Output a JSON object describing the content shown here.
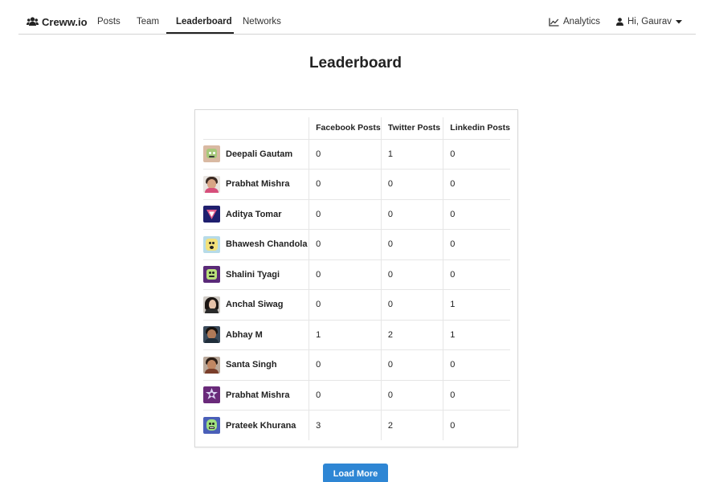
{
  "brand": {
    "name": "Creww.io",
    "icon": "users-icon"
  },
  "nav": {
    "links": [
      {
        "label": "Posts"
      },
      {
        "label": "Team"
      },
      {
        "label": "Leaderboard",
        "active": true
      },
      {
        "label": "Networks"
      }
    ],
    "analytics": {
      "label": "Analytics",
      "icon": "line-chart-icon"
    },
    "user_menu": {
      "label": "Hi, Gaurav",
      "icon": "user-icon"
    }
  },
  "page": {
    "title": "Leaderboard"
  },
  "table": {
    "headers": [
      "",
      "Facebook Posts",
      "Twitter Posts",
      "Linkedin Posts"
    ],
    "rows": [
      {
        "name": "Deepali Gautam",
        "facebook": "0",
        "twitter": "1",
        "linkedin": "0"
      },
      {
        "name": "Prabhat Mishra",
        "facebook": "0",
        "twitter": "0",
        "linkedin": "0"
      },
      {
        "name": "Aditya Tomar",
        "facebook": "0",
        "twitter": "0",
        "linkedin": "0"
      },
      {
        "name": "Bhawesh Chandola",
        "facebook": "0",
        "twitter": "0",
        "linkedin": "0"
      },
      {
        "name": "Shalini Tyagi",
        "facebook": "0",
        "twitter": "0",
        "linkedin": "0"
      },
      {
        "name": "Anchal Siwag",
        "facebook": "0",
        "twitter": "0",
        "linkedin": "1"
      },
      {
        "name": "Abhay M",
        "facebook": "1",
        "twitter": "2",
        "linkedin": "1"
      },
      {
        "name": "Santa Singh",
        "facebook": "0",
        "twitter": "0",
        "linkedin": "0"
      },
      {
        "name": "Prabhat Mishra",
        "facebook": "0",
        "twitter": "0",
        "linkedin": "0"
      },
      {
        "name": "Prateek Khurana",
        "facebook": "3",
        "twitter": "2",
        "linkedin": "0"
      }
    ]
  },
  "load_more": {
    "label": "Load More"
  },
  "colors": {
    "primary_button": "#2e86d4",
    "text": "#222222",
    "border": "#d8d8d8"
  }
}
